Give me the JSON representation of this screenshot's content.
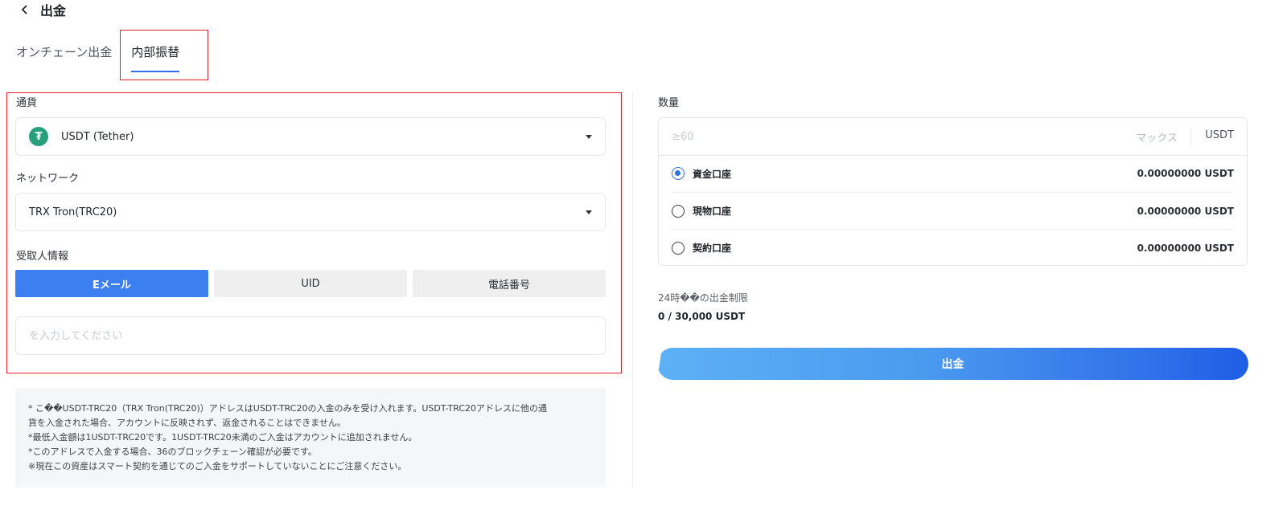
{
  "header": {
    "title": "出金",
    "back_icon": "chevron-left-icon"
  },
  "tabs": [
    {
      "label": "オンチェーン出金",
      "active": false
    },
    {
      "label": "内部振替",
      "active": true
    }
  ],
  "currency": {
    "label": "通貨",
    "value": "USDT (Tether)",
    "icon": "tether-icon",
    "icon_glyph": "₮"
  },
  "network": {
    "label": "ネットワーク",
    "value": "TRX Tron(TRC20)"
  },
  "recipient": {
    "label": "受取人情報",
    "options": [
      {
        "label": "Eメール",
        "active": true
      },
      {
        "label": "UID",
        "active": false
      },
      {
        "label": "電話番号",
        "active": false
      }
    ],
    "placeholder": "を入力してください"
  },
  "notice": [
    "* こ��USDT-TRC20（TRX Tron(TRC20)）アドレスはUSDT-TRC20の入金のみを受け入れます。USDT-TRC20アドレスに他の通",
    "貨を入金された場合、アカウントに反映されず、返金されることはできません。",
    "*最低入金額は1USDT-TRC20です。1USDT-TRC20未満のご入金はアカウントに追加されません。",
    "*このアドレスで入金する場合、36のブロックチェーン確認が必要です。",
    "※現在この資産はスマート契約を通じてのご入金をサポートしていないことにご注意ください。"
  ],
  "amount": {
    "label": "数量",
    "placeholder": "≥60",
    "max_label": "マックス",
    "unit": "USDT"
  },
  "accounts": [
    {
      "name": "資金口座",
      "balance": "0.00000000 USDT",
      "selected": true
    },
    {
      "name": "現物口座",
      "balance": "0.00000000 USDT",
      "selected": false
    },
    {
      "name": "契約口座",
      "balance": "0.00000000 USDT",
      "selected": false
    }
  ],
  "limit": {
    "label": "24時��の出金制限",
    "value": "0 / 30,000 USDT"
  },
  "submit_label": "出金",
  "colors": {
    "accent": "#2f6fe9",
    "highlight_border": "#e0202a",
    "tether": "#26a17b"
  }
}
